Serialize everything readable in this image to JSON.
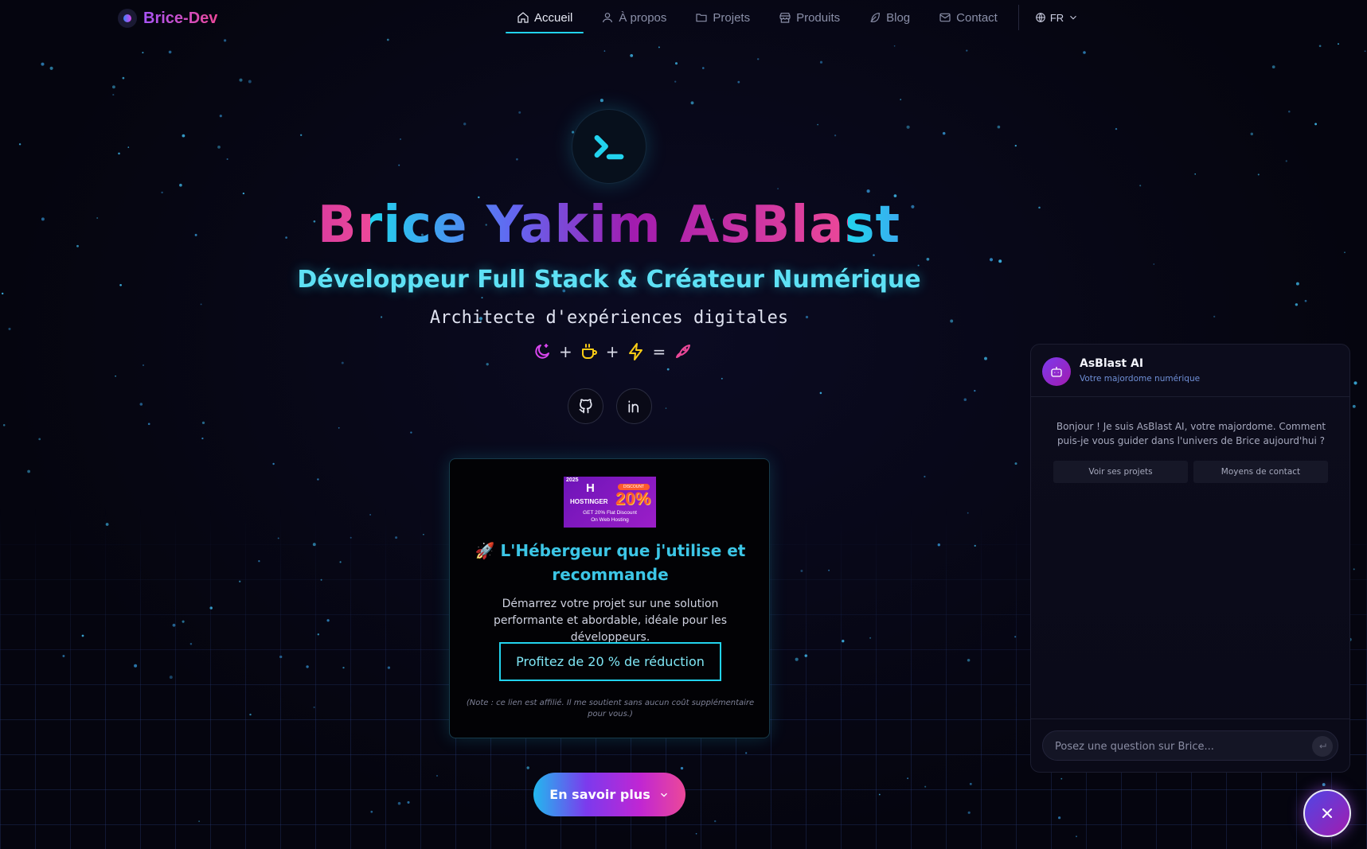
{
  "brand": {
    "name": "Brice-Dev"
  },
  "nav": {
    "items": [
      {
        "label": "Accueil",
        "icon": "home-icon",
        "active": true
      },
      {
        "label": "À propos",
        "icon": "user-icon",
        "active": false
      },
      {
        "label": "Projets",
        "icon": "folder-icon",
        "active": false
      },
      {
        "label": "Produits",
        "icon": "store-icon",
        "active": false
      },
      {
        "label": "Blog",
        "icon": "feather-icon",
        "active": false
      },
      {
        "label": "Contact",
        "icon": "mail-icon",
        "active": false
      }
    ],
    "language": "FR"
  },
  "hero": {
    "name": "Brice Yakim AsBlast",
    "subtitle": "Développeur Full Stack & Créateur Numérique",
    "tagline": "Architecte d'expériences digitales",
    "equation": {
      "plus1": "+",
      "plus2": "+",
      "equals": "="
    },
    "equation_icons": [
      "moon-icon",
      "coffee-icon",
      "zap-icon",
      "rocket-icon"
    ],
    "socials": [
      "github-icon",
      "linkedin-icon"
    ]
  },
  "promo": {
    "banner": {
      "year": "2025",
      "brand": "HOSTINGER",
      "badge": "DISCOUNT",
      "percent": "20%",
      "line1": "GET 20% Flat Discount",
      "line2": "On Web Hosting"
    },
    "title": "🚀 L'Hébergeur que j'utilise et recommande",
    "description": "Démarrez votre projet sur une solution performante et abordable, idéale pour les développeurs.",
    "button": "Profitez de 20 % de réduction",
    "note": "(Note : ce lien est affilié. Il me soutient sans aucun coût supplémentaire pour vous.)"
  },
  "more_button": "En savoir plus",
  "chat": {
    "name": "AsBlast AI",
    "status": "Votre majordome numérique",
    "message": "Bonjour ! Je suis AsBlast AI, votre majordome. Comment puis-je vous guider dans l'univers de Brice aujourd'hui ?",
    "chips": [
      "Voir ses projets",
      "Moyens de contact"
    ],
    "input_placeholder": "Posez une question sur Brice..."
  },
  "colors": {
    "accent_cyan": "#22d3ee",
    "accent_purple": "#a855f7",
    "accent_pink": "#ec4899",
    "background": "#05050f"
  }
}
